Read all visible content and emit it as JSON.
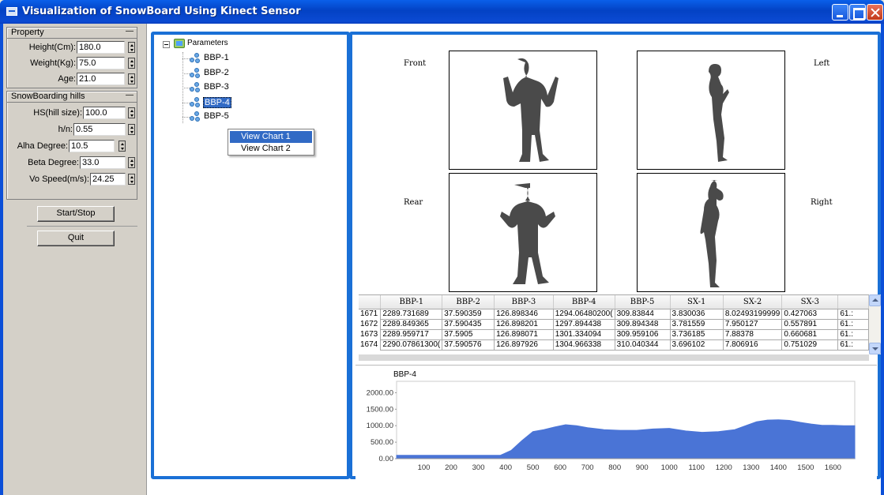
{
  "window": {
    "title": "Visualization of SnowBoard Using Kinect Sensor"
  },
  "property": {
    "title": "Property",
    "collapse": "—",
    "fields": [
      {
        "label": "Height(Cm):",
        "value": "180.0"
      },
      {
        "label": "Weight(Kg):",
        "value": "75.0"
      },
      {
        "label": "Age:",
        "value": "21.0"
      }
    ]
  },
  "hills": {
    "title": "SnowBoarding hills",
    "collapse": "—",
    "fields": [
      {
        "label": "HS(hill size):",
        "value": "100.0"
      },
      {
        "label": "h/n:",
        "value": "0.55"
      },
      {
        "label": "Alha Degree:",
        "value": "10.5"
      },
      {
        "label": "Beta Degree:",
        "value": "33.0"
      },
      {
        "label": "Vo Speed(m/s):",
        "value": "24.25"
      }
    ]
  },
  "buttons": {
    "start_stop": "Start/Stop",
    "quit": "Quit"
  },
  "tree": {
    "root": "Parameters",
    "items": [
      "BBP-1",
      "BBP-2",
      "BBP-3",
      "BBP-4",
      "BBP-5"
    ],
    "selected_index": 3
  },
  "context_menu": {
    "items": [
      "View Chart 1",
      "View Chart 2"
    ],
    "highlighted_index": 0
  },
  "views": {
    "front": "Front",
    "left": "Left",
    "rear": "Rear",
    "right": "Right"
  },
  "grid": {
    "columns": [
      "BBP-1",
      "BBP-2",
      "BBP-3",
      "BBP-4",
      "BBP-5",
      "SX-1",
      "SX-2",
      "SX-3",
      ""
    ],
    "rows": [
      {
        "id": "1671",
        "cells": [
          "2289.731689",
          "37.590359",
          "126.898346",
          "1294.06480200(",
          "309.83844",
          "3.830036",
          "8.02493199999",
          "0.427063",
          "61.:"
        ]
      },
      {
        "id": "1672",
        "cells": [
          "2289.849365",
          "37.590435",
          "126.898201",
          "1297.894438",
          "309.894348",
          "3.781559",
          "7.950127",
          "0.557891",
          "61.:"
        ]
      },
      {
        "id": "1673",
        "cells": [
          "2289.959717",
          "37.5905",
          "126.898071",
          "1301.334094",
          "309.959106",
          "3.736185",
          "7.88378",
          "0.660681",
          "61.:"
        ]
      },
      {
        "id": "1674",
        "cells": [
          "2290.07861300(",
          "37.590576",
          "126.897926",
          "1304.966338",
          "310.040344",
          "3.696102",
          "7.806916",
          "0.751029",
          "61.:"
        ]
      }
    ]
  },
  "chart_data": {
    "type": "area",
    "title": "BBP-4",
    "xlabel": "",
    "ylabel": "",
    "xlim": [
      0,
      1680
    ],
    "ylim": [
      0,
      2250
    ],
    "xticks": [
      100,
      200,
      300,
      400,
      500,
      600,
      700,
      800,
      900,
      1000,
      1100,
      1200,
      1300,
      1400,
      1500,
      1600
    ],
    "yticks": [
      "0.00",
      "500.00",
      "1000.00",
      "1500.00",
      "2000.00"
    ],
    "yticks_values": [
      0,
      500,
      1000,
      1500,
      2000
    ],
    "color": "#4a74d6",
    "x": [
      0,
      100,
      200,
      300,
      380,
      420,
      460,
      500,
      540,
      580,
      620,
      660,
      700,
      760,
      820,
      880,
      940,
      1000,
      1060,
      1120,
      1180,
      1240,
      1280,
      1320,
      1360,
      1400,
      1440,
      1480,
      1520,
      1560,
      1600,
      1640,
      1680
    ],
    "y": [
      100,
      100,
      100,
      100,
      100,
      250,
      550,
      820,
      880,
      960,
      1030,
      1000,
      940,
      880,
      860,
      860,
      900,
      920,
      840,
      800,
      820,
      880,
      1000,
      1120,
      1170,
      1180,
      1160,
      1100,
      1050,
      1010,
      1010,
      1000,
      1000
    ]
  }
}
